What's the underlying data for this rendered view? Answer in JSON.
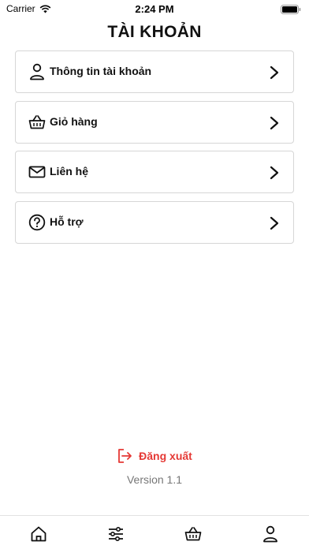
{
  "status_bar": {
    "carrier": "Carrier",
    "time": "2:24 PM"
  },
  "header": {
    "title": "TÀI KHOẢN"
  },
  "menu": {
    "items": [
      {
        "label": "Thông tin tài khoản",
        "icon": "user-icon"
      },
      {
        "label": "Giỏ hàng",
        "icon": "basket-icon"
      },
      {
        "label": "Liên hệ",
        "icon": "mail-icon"
      },
      {
        "label": "Hỗ trợ",
        "icon": "help-icon"
      }
    ]
  },
  "footer": {
    "logout_label": "Đăng xuất",
    "version": "Version 1.1"
  },
  "tab_bar": {
    "tabs": [
      {
        "icon": "home-icon"
      },
      {
        "icon": "filter-icon"
      },
      {
        "icon": "basket-icon"
      },
      {
        "icon": "user-icon"
      }
    ]
  },
  "colors": {
    "accent_red": "#e53935",
    "border": "#d6d6d6",
    "text": "#111111",
    "muted": "#777777"
  }
}
